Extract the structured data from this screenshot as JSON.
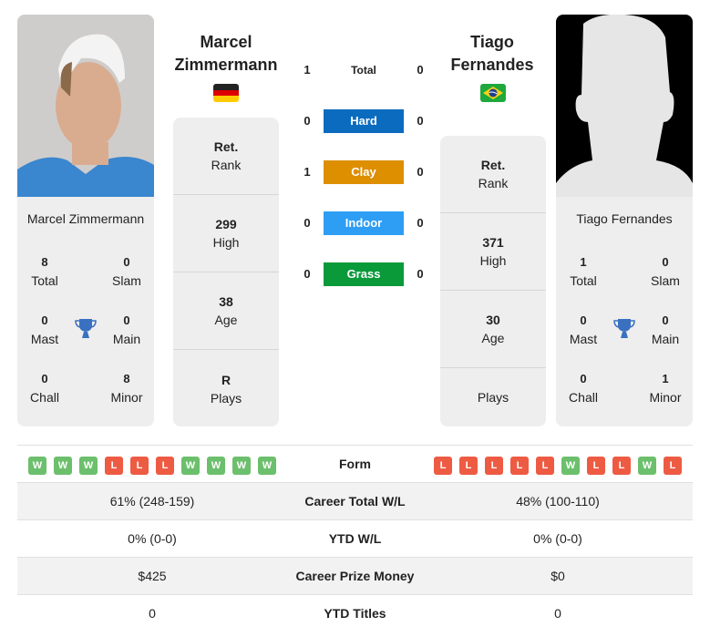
{
  "left": {
    "name_line1": "Marcel",
    "name_line2": "Zimmermann",
    "full_name": "Marcel Zimmermann",
    "flag": "germany",
    "photo": "player-photo",
    "titles": {
      "total": "8",
      "total_label": "Total",
      "slam": "0",
      "slam_label": "Slam",
      "mast": "0",
      "mast_label": "Mast",
      "main": "0",
      "main_label": "Main",
      "chall": "0",
      "chall_label": "Chall",
      "minor": "8",
      "minor_label": "Minor"
    },
    "info": [
      {
        "value": "Ret.",
        "label": "Rank"
      },
      {
        "value": "299",
        "label": "High"
      },
      {
        "value": "38",
        "label": "Age"
      },
      {
        "value": "R",
        "label": "Plays"
      }
    ],
    "form": [
      "W",
      "W",
      "W",
      "L",
      "L",
      "L",
      "W",
      "W",
      "W",
      "W"
    ]
  },
  "right": {
    "name_line1": "Tiago",
    "name_line2": "Fernandes",
    "full_name": "Tiago Fernandes",
    "flag": "brazil",
    "photo": "silhouette-placeholder",
    "titles": {
      "total": "1",
      "total_label": "Total",
      "slam": "0",
      "slam_label": "Slam",
      "mast": "0",
      "mast_label": "Mast",
      "main": "0",
      "main_label": "Main",
      "chall": "0",
      "chall_label": "Chall",
      "minor": "1",
      "minor_label": "Minor"
    },
    "info": [
      {
        "value": "Ret.",
        "label": "Rank"
      },
      {
        "value": "371",
        "label": "High"
      },
      {
        "value": "30",
        "label": "Age"
      },
      {
        "value": "",
        "label": "Plays"
      }
    ],
    "form": [
      "L",
      "L",
      "L",
      "L",
      "L",
      "W",
      "L",
      "L",
      "W",
      "L"
    ]
  },
  "h2h": [
    {
      "label": "Total",
      "left": "1",
      "right": "0",
      "color": ""
    },
    {
      "label": "Hard",
      "left": "0",
      "right": "0",
      "color": "#0a6bbf"
    },
    {
      "label": "Clay",
      "left": "1",
      "right": "0",
      "color": "#dd8f00"
    },
    {
      "label": "Indoor",
      "left": "0",
      "right": "0",
      "color": "#2e9ef4"
    },
    {
      "label": "Grass",
      "left": "0",
      "right": "0",
      "color": "#0a9a3a"
    }
  ],
  "table": {
    "form_label": "Form",
    "rows": [
      {
        "label": "Career Total W/L",
        "left": "61% (248-159)",
        "right": "48% (100-110)"
      },
      {
        "label": "YTD W/L",
        "left": "0% (0-0)",
        "right": "0% (0-0)"
      },
      {
        "label": "Career Prize Money",
        "left": "$425",
        "right": "$0"
      },
      {
        "label": "YTD Titles",
        "left": "0",
        "right": "0"
      }
    ]
  }
}
